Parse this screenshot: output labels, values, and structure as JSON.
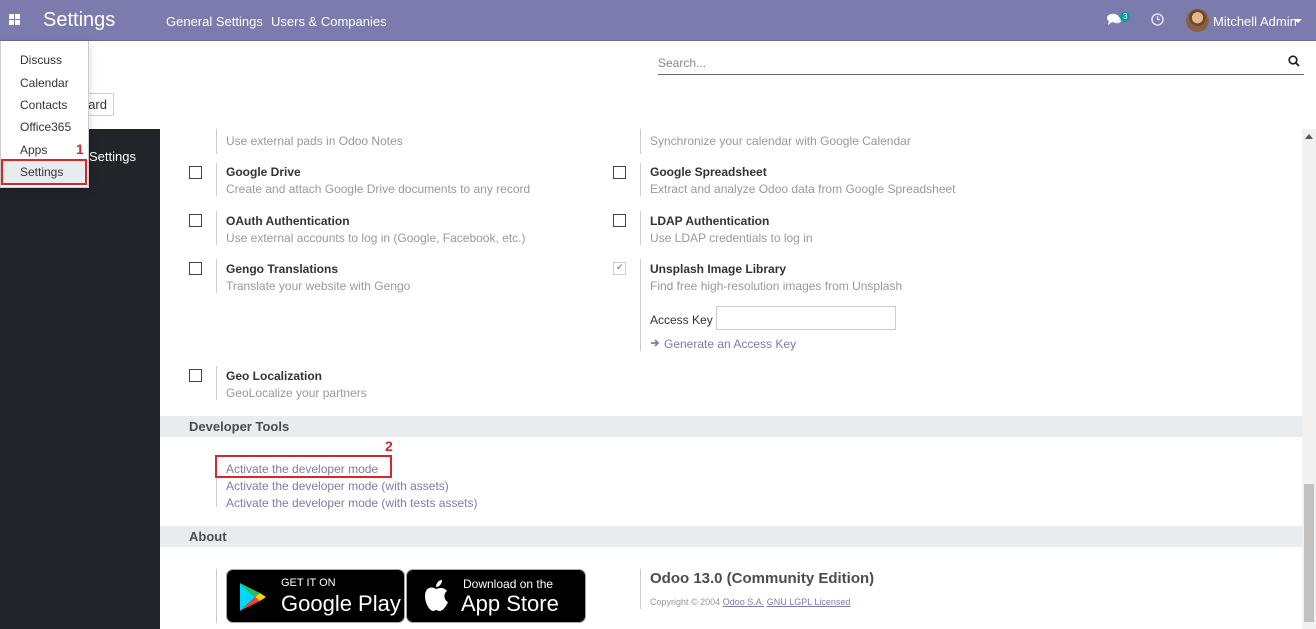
{
  "navbar": {
    "brand": "Settings",
    "menu": [
      "General Settings",
      "Users & Companies"
    ],
    "chat_badge": "3",
    "user_name": "Mitchell Admin",
    "icons": [
      "apps-icon",
      "chat-icon",
      "clock-icon",
      "chevron-down-icon"
    ]
  },
  "search": {
    "placeholder": "Search..."
  },
  "hidden_button_label_fragment": "ard",
  "sidebar": {
    "partial_label": "Settings"
  },
  "dropdown": {
    "items": [
      "Discuss",
      "Calendar",
      "Contacts",
      "Office365",
      "Apps",
      "Settings"
    ],
    "active": "Settings"
  },
  "annotations": {
    "step1": "1",
    "step2": "2",
    "highlight_color": "#d6272a"
  },
  "integrations": {
    "top_left_desc": "Use external pads in Odoo Notes",
    "top_right_desc": "Synchronize your calendar with Google Calendar",
    "items": [
      {
        "title": "Google Drive",
        "desc": "Create and attach Google Drive documents to any record",
        "checked": false
      },
      {
        "title": "Google Spreadsheet",
        "desc": "Extract and analyze Odoo data from Google Spreadsheet",
        "checked": false
      },
      {
        "title": "OAuth Authentication",
        "desc": "Use external accounts to log in (Google, Facebook, etc.)",
        "checked": false
      },
      {
        "title": "LDAP Authentication",
        "desc": "Use LDAP credentials to log in",
        "checked": false
      },
      {
        "title": "Gengo Translations",
        "desc": "Translate your website with Gengo",
        "checked": false
      },
      {
        "title": "Unsplash Image Library",
        "desc": "Find free high-resolution images from Unsplash",
        "checked": true
      },
      {
        "title": "Geo Localization",
        "desc": "GeoLocalize your partners",
        "checked": false
      }
    ],
    "access_key_label": "Access Key",
    "generate_key_link": "Generate an Access Key"
  },
  "developer_tools": {
    "title": "Developer Tools",
    "links": [
      "Activate the developer mode",
      "Activate the developer mode (with assets)",
      "Activate the developer mode (with tests assets)"
    ]
  },
  "about": {
    "title": "About",
    "google_play": {
      "small": "GET IT ON",
      "big": "Google Play"
    },
    "app_store": {
      "small": "Download on the",
      "big": "App Store"
    },
    "edition": "Odoo 13.0 (Community Edition)",
    "copyright_prefix": "Copyright © 2004",
    "company_link": "Odoo S.A.",
    "license_link": "GNU LGPL Licensed"
  },
  "colors": {
    "navbar": "#7c7bad",
    "sidebar": "#212529",
    "link": "#7c7bad",
    "badge": "#00a09d"
  }
}
